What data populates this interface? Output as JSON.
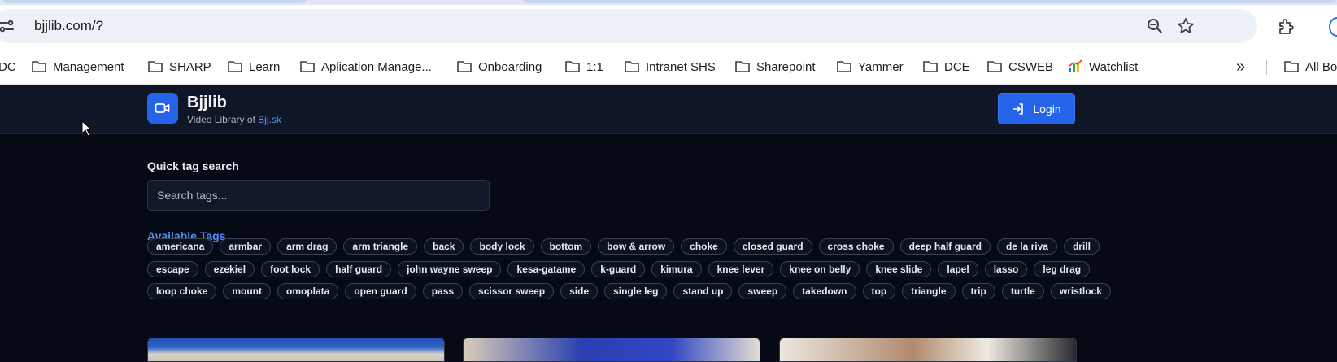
{
  "browser": {
    "url": "bjjlib.com/?",
    "bookmarks": [
      {
        "label": "DC",
        "icon": "folder-icon"
      },
      {
        "label": "Management",
        "icon": "folder-icon"
      },
      {
        "label": "SHARP",
        "icon": "folder-icon"
      },
      {
        "label": "Learn",
        "icon": "folder-icon"
      },
      {
        "label": "Aplication Manage...",
        "icon": "folder-icon"
      },
      {
        "label": "Onboarding",
        "icon": "folder-icon"
      },
      {
        "label": "1:1",
        "icon": "folder-icon"
      },
      {
        "label": "Intranet SHS",
        "icon": "folder-icon"
      },
      {
        "label": "Sharepoint",
        "icon": "folder-icon"
      },
      {
        "label": "Yammer",
        "icon": "folder-icon"
      },
      {
        "label": "DCE",
        "icon": "folder-icon"
      },
      {
        "label": "CSWEB",
        "icon": "folder-icon"
      },
      {
        "label": "Watchlist",
        "icon": "watchlist-icon"
      }
    ],
    "overflow_label": "»",
    "all_bookmarks_label": "All Bo"
  },
  "header": {
    "brand_name": "Bjjlib",
    "subtitle_prefix": "Video Library of ",
    "subtitle_link": "Bjj.sk",
    "login_label": "Login"
  },
  "search": {
    "label": "Quick tag search",
    "placeholder": "Search tags...",
    "value": ""
  },
  "tags": {
    "title": "Available Tags",
    "rows": [
      [
        "americana",
        "armbar",
        "arm drag",
        "arm triangle",
        "back",
        "body lock",
        "bottom",
        "bow & arrow",
        "choke",
        "closed guard",
        "cross choke",
        "deep half guard",
        "de la riva",
        "drill"
      ],
      [
        "escape",
        "ezekiel",
        "foot lock",
        "half guard",
        "john wayne sweep",
        "kesa-gatame",
        "k-guard",
        "kimura",
        "knee lever",
        "knee on belly",
        "knee slide",
        "lapel",
        "lasso",
        "leg drag"
      ],
      [
        "loop choke",
        "mount",
        "omoplata",
        "open guard",
        "pass",
        "scissor sweep",
        "side",
        "single leg",
        "stand up",
        "sweep",
        "takedown",
        "top",
        "triangle",
        "trip",
        "turtle",
        "wristlock"
      ]
    ]
  },
  "colors": {
    "accent": "#2563eb",
    "link": "#4f8ef7",
    "page_bg": "#050a14",
    "header_bg": "#0f1626"
  }
}
